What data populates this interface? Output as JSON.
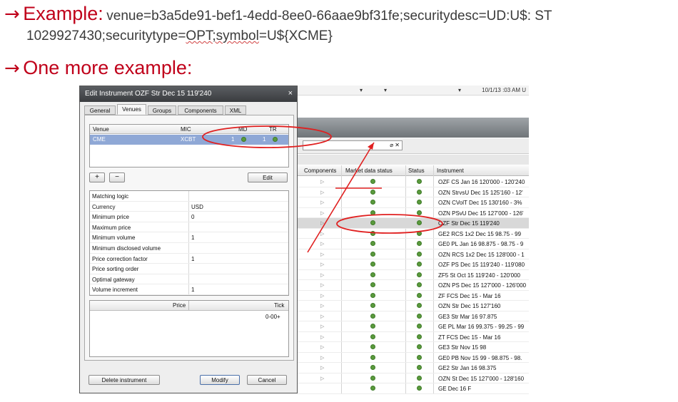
{
  "slide": {
    "example_label": "Example:",
    "example_code_line1": "venue=b3a5de91-bef1-4edd-8ee0-66aae9bf31fe;securitydesc=UD:U$: ST",
    "example_code_line2a": "1029927430;securitytype=",
    "example_code_line2b": "OPT;symbol",
    "example_code_line2c": "=U${XCME}",
    "more_label": "One more example:"
  },
  "dialog": {
    "title": "Edit Instrument OZF Str Dec 15 119'240",
    "close": "×",
    "tabs": [
      "General",
      "Venues",
      "Groups",
      "Components",
      "XML"
    ],
    "venues_table": {
      "headers": [
        "Venue",
        "MIC",
        "MD",
        "TR"
      ],
      "row": {
        "venue": "CME",
        "mic": "XCBT",
        "md": "1",
        "tr": "1"
      }
    },
    "add_label": "+",
    "remove_label": "−",
    "edit_label": "Edit",
    "properties": [
      {
        "key": "Matching logic",
        "value": ""
      },
      {
        "key": "Currency",
        "value": "USD"
      },
      {
        "key": "Minimum price",
        "value": "0"
      },
      {
        "key": "Maximum price",
        "value": ""
      },
      {
        "key": "Minimum volume",
        "value": "1"
      },
      {
        "key": "Minimum disclosed volume",
        "value": ""
      },
      {
        "key": "Price correction factor",
        "value": "1"
      },
      {
        "key": "Price sorting order",
        "value": ""
      },
      {
        "key": "Optimal gateway",
        "value": ""
      },
      {
        "key": "Volume increment",
        "value": "1"
      }
    ],
    "tick_table": {
      "headers": [
        "Price",
        "Tick"
      ],
      "row": {
        "price": "",
        "tick": "0-00+"
      }
    },
    "delete_label": "Delete instrument",
    "modify_label": "Modify",
    "cancel_label": "Cancel"
  },
  "grid": {
    "topbar_date": "10/1/13   :03 AM  U",
    "headers": [
      "Components",
      "Market data status",
      "Status",
      "Instrument"
    ],
    "rows": [
      "OZF CS Jan 16 120'000 - 120'240",
      "OZN StrvsU Dec 15 125'160 - 12'",
      "OZN CVolT Dec 15 130'160 - 3%",
      "OZN PSvU Dec 15 127'000 - 126'",
      "OZF Str Dec 15 119'240",
      "GE2 RCS 1x2 Dec 15 98.75 - 99",
      "GE0 PL Jan 16 98.875 - 98.75 - 9",
      "OZN RCS 1x2 Dec 15 128'000 - 1",
      "OZF PS Dec 15 119'240 - 119'080",
      "ZF5 St Oct 15 119'240 - 120'000",
      "OZN PS Dec 15 127'000 - 126'000",
      "ZF FCS Dec 15 - Mar 16",
      "OZN Str Dec 15 127'160",
      "GE3 Str Mar 16 97.875",
      "GE PL Mar 16 99.375 - 99.25 - 99",
      "ZT FCS Dec 15 - Mar 16",
      "GE3 Str Nov 15 98",
      "GE0 PB Nov 15 99 - 98.875 - 98.",
      "GE2 Str Jan 16 98.375",
      "OZN St Dec 15 127'000 - 128'160",
      "GE Dec 16 F"
    ],
    "selected_index": 4
  },
  "colors": {
    "accent": "#c0001a",
    "annotation": "#e02020",
    "status_green": "#5a9a3c",
    "selected_venue": "#8fa8d6"
  }
}
